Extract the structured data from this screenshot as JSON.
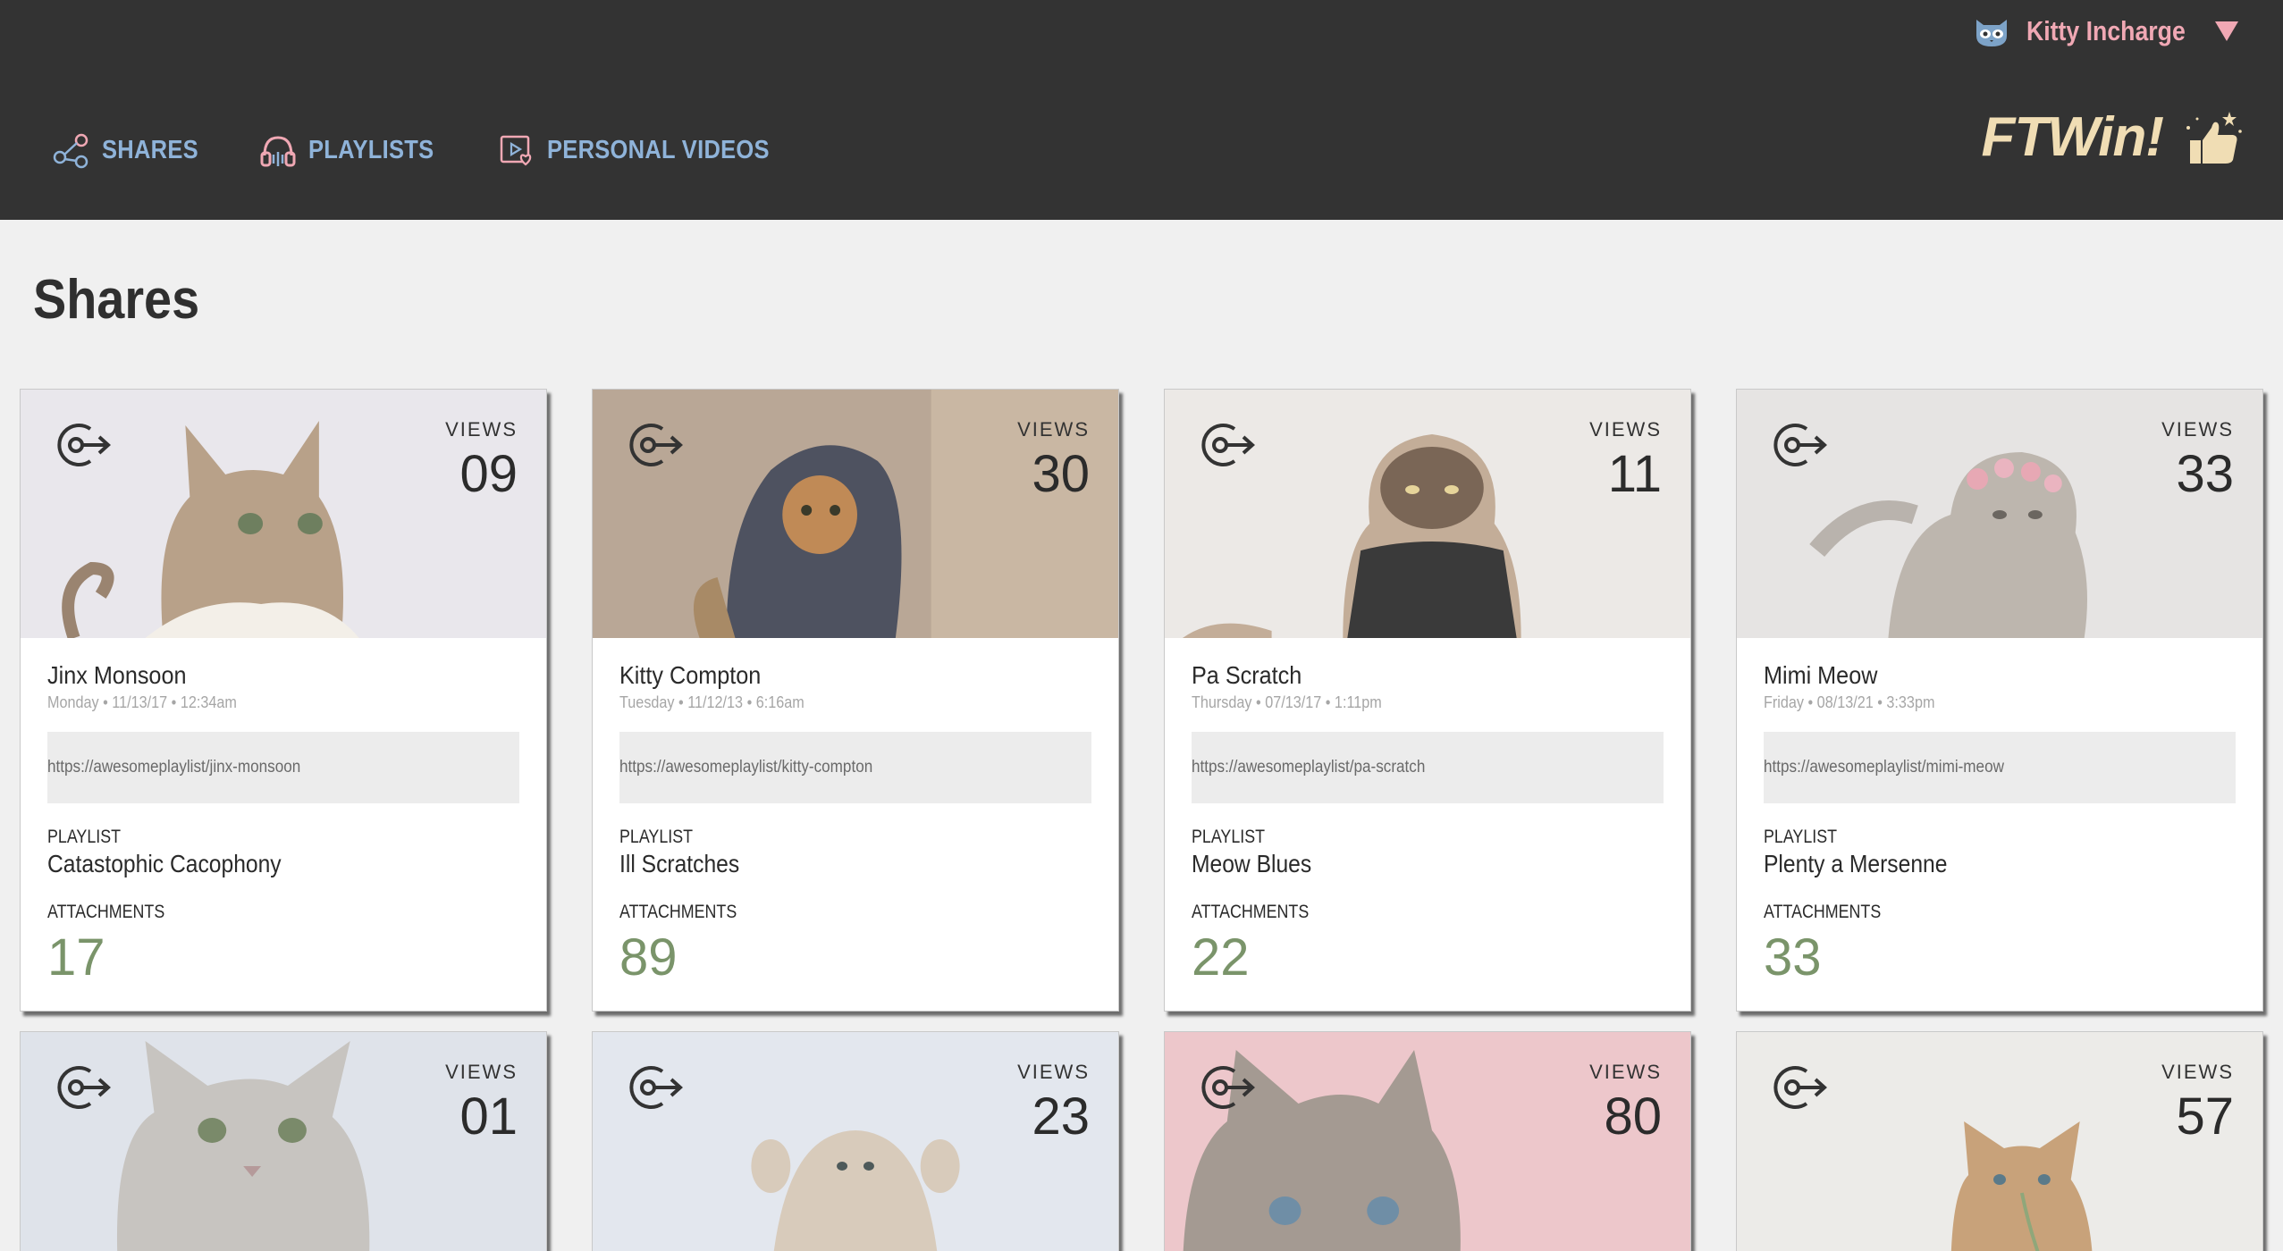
{
  "header": {
    "user_name": "Kitty Incharge",
    "nav": [
      {
        "label": "SHARES",
        "icon": "share-icon"
      },
      {
        "label": "PLAYLISTS",
        "icon": "headphones-icon"
      },
      {
        "label": "PERSONAL VIDEOS",
        "icon": "video-heart-icon"
      }
    ],
    "brand": "FTWin!",
    "brand_icon": "thumbs-up-icon"
  },
  "page": {
    "title": "Shares"
  },
  "labels": {
    "views": "VIEWS",
    "playlist": "PLAYLIST",
    "attachments": "ATTACHMENTS"
  },
  "colors": {
    "header_bg": "#333333",
    "nav_text": "#8fb3d9",
    "user_text": "#f0a8b4",
    "brand_text": "#f0ddb4",
    "attachments_count": "#7a946a",
    "page_bg": "#f0f0f0"
  },
  "cards": [
    {
      "views": "09",
      "name": "Jinx Monsoon",
      "date": "Monday • 11/13/17 • 12:34am",
      "url": "https://awesomeplaylist/jinx-monsoon",
      "playlist": "Catastophic Cacophony",
      "attachments": "17"
    },
    {
      "views": "30",
      "name": "Kitty Compton",
      "date": "Tuesday • 11/12/13 • 6:16am",
      "url": "https://awesomeplaylist/kitty-compton",
      "playlist": "Ill Scratches",
      "attachments": "89"
    },
    {
      "views": "11",
      "name": "Pa Scratch",
      "date": "Thursday • 07/13/17 • 1:11pm",
      "url": "https://awesomeplaylist/pa-scratch",
      "playlist": "Meow Blues",
      "attachments": "22"
    },
    {
      "views": "33",
      "name": "Mimi Meow",
      "date": "Friday • 08/13/21 • 3:33pm",
      "url": "https://awesomeplaylist/mimi-meow",
      "playlist": "Plenty a Mersenne",
      "attachments": "33"
    },
    {
      "views": "01"
    },
    {
      "views": "23"
    },
    {
      "views": "80"
    },
    {
      "views": "57"
    }
  ]
}
